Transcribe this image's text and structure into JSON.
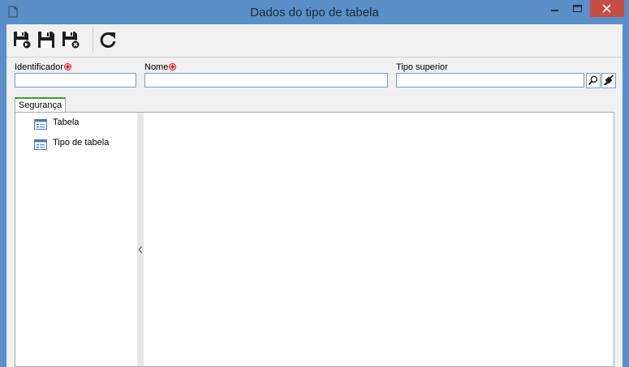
{
  "window": {
    "title": "Dados do tipo de tabela"
  },
  "toolbar": {
    "buttons": [
      {
        "name": "save-new-button",
        "icon": "save-new-icon"
      },
      {
        "name": "save-button",
        "icon": "save-icon"
      },
      {
        "name": "save-close-button",
        "icon": "save-close-icon"
      },
      {
        "name": "refresh-button",
        "icon": "refresh-icon"
      }
    ]
  },
  "form": {
    "identificador_label": "Identificador",
    "identificador_value": "",
    "nome_label": "Nome",
    "nome_value": "",
    "tipo_superior_label": "Tipo superior",
    "tipo_superior_value": ""
  },
  "tabs": [
    {
      "label": "Segurança",
      "active": true
    }
  ],
  "tree": {
    "items": [
      {
        "label": "Tabela",
        "icon": "list-form-icon"
      },
      {
        "label": "Tipo de tabela",
        "icon": "list-form-icon"
      }
    ]
  },
  "colors": {
    "title_bar": "#5a8fc8",
    "close_button": "#c74e43",
    "required_marker": "#d22020",
    "active_tab_accent": "#3c9b3c",
    "field_border": "#7a9cc6"
  }
}
